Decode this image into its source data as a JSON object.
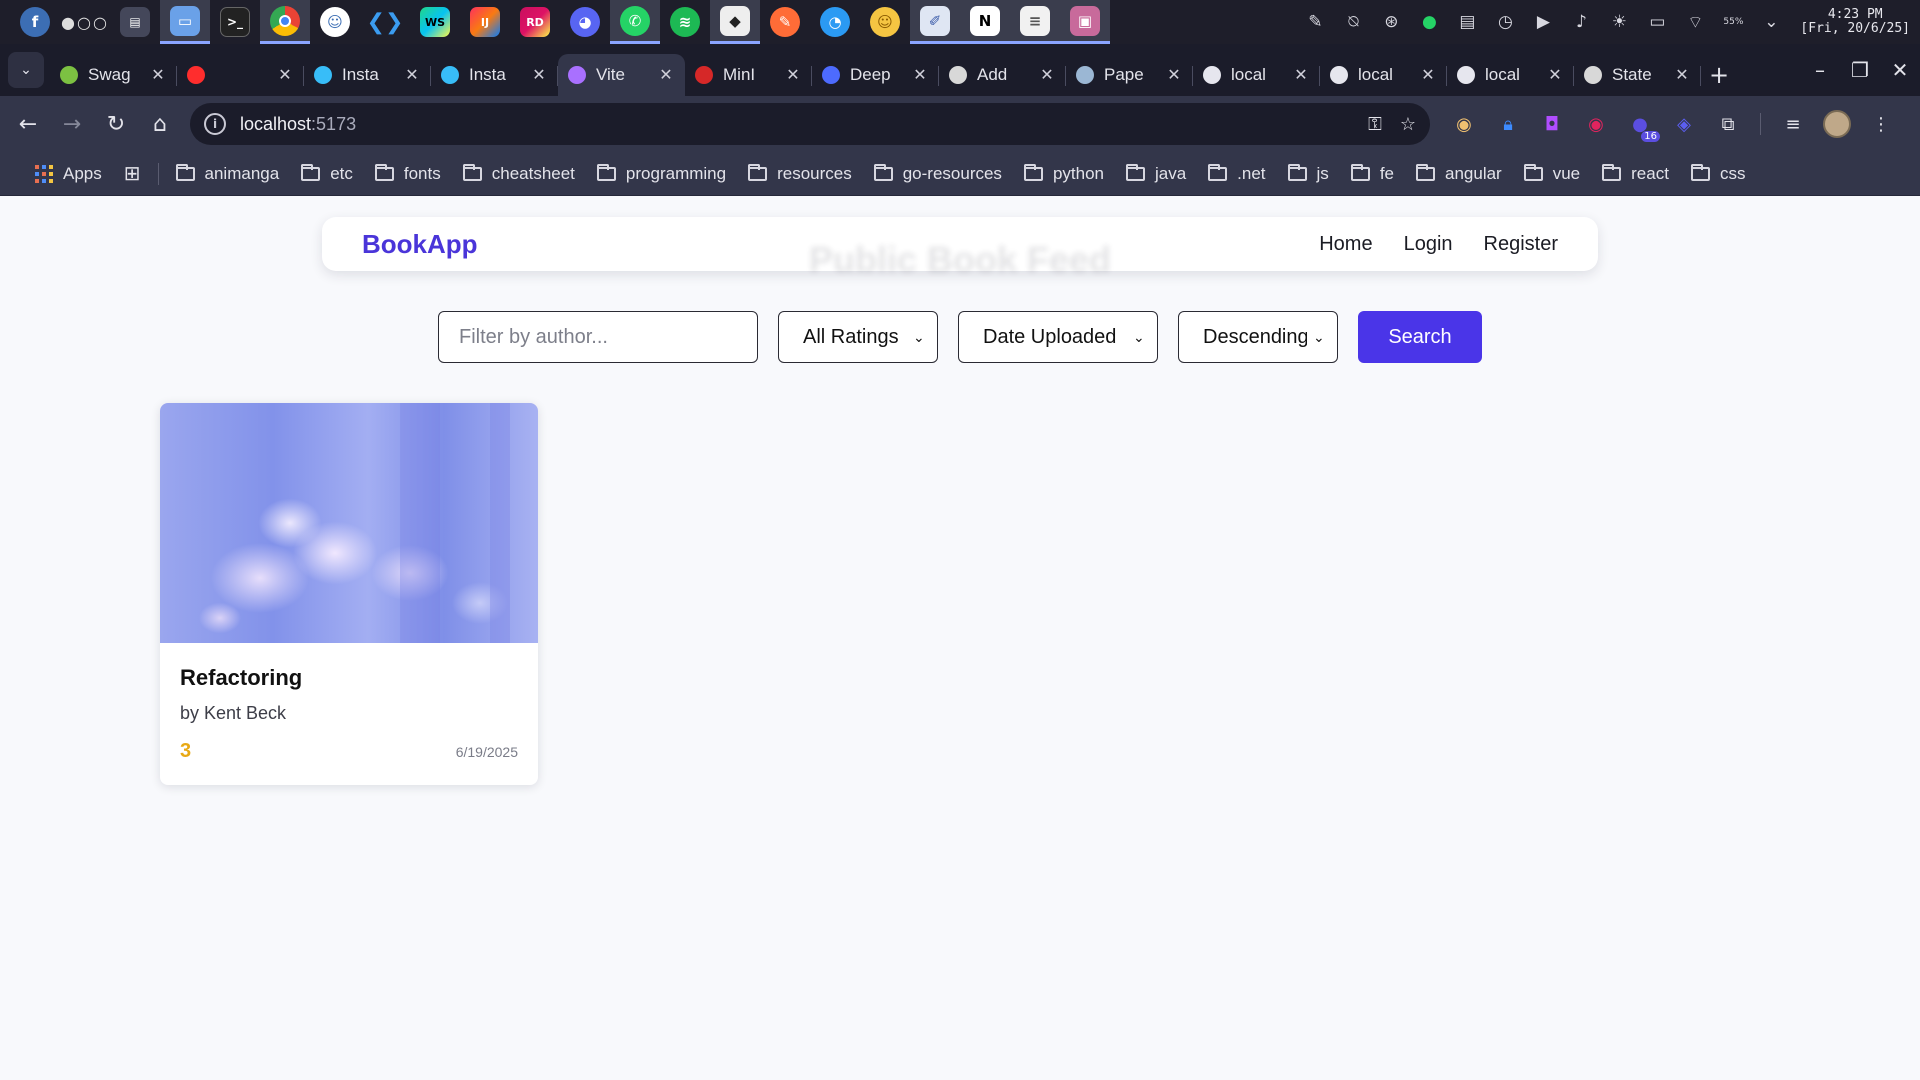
{
  "taskbar": {
    "clock_time": "4:23 PM",
    "clock_date": "[Fri, 20/6/25]",
    "battery_percent": "55%"
  },
  "browser": {
    "tabs": [
      {
        "title": "Swag",
        "color": "#7cc142"
      },
      {
        "title": "",
        "color": "#ff2d2d"
      },
      {
        "title": "Insta",
        "color": "#38bdf8"
      },
      {
        "title": "Insta",
        "color": "#38bdf8"
      },
      {
        "title": "Vite",
        "color": "#a970ff",
        "active": true
      },
      {
        "title": "MinI",
        "color": "#d62828"
      },
      {
        "title": "Deep",
        "color": "#4d6bfe"
      },
      {
        "title": "Add",
        "color": "#d8d8d8"
      },
      {
        "title": "Pape",
        "color": "#9bb7d4"
      },
      {
        "title": "local",
        "color": "#e6e6ee"
      },
      {
        "title": "local",
        "color": "#e6e6ee"
      },
      {
        "title": "local",
        "color": "#e6e6ee"
      },
      {
        "title": "State",
        "color": "#d8d8d8"
      }
    ],
    "url_host": "localhost",
    "url_port": ":5173",
    "extension_badge": "16",
    "bookmarks": {
      "apps_label": "Apps",
      "folders": [
        "animanga",
        "etc",
        "fonts",
        "cheatsheet",
        "programming",
        "resources",
        "go-resources",
        "python",
        "java",
        ".net",
        "js",
        "fe",
        "angular",
        "vue",
        "react",
        "css"
      ]
    }
  },
  "app": {
    "brand": "BookApp",
    "ghost_heading": "Public Book Feed",
    "nav": {
      "home": "Home",
      "login": "Login",
      "register": "Register"
    },
    "filters": {
      "author_placeholder": "Filter by author...",
      "rating_selected": "All Ratings",
      "sort_by_selected": "Date Uploaded",
      "order_selected": "Descending",
      "search_label": "Search"
    },
    "books": [
      {
        "title": "Refactoring",
        "author": "by Kent Beck",
        "rating": "3",
        "date": "6/19/2025"
      }
    ]
  },
  "colors": {
    "brand": "#4a35d9",
    "primary_button": "#4a35e8",
    "rating": "#e8a915"
  }
}
